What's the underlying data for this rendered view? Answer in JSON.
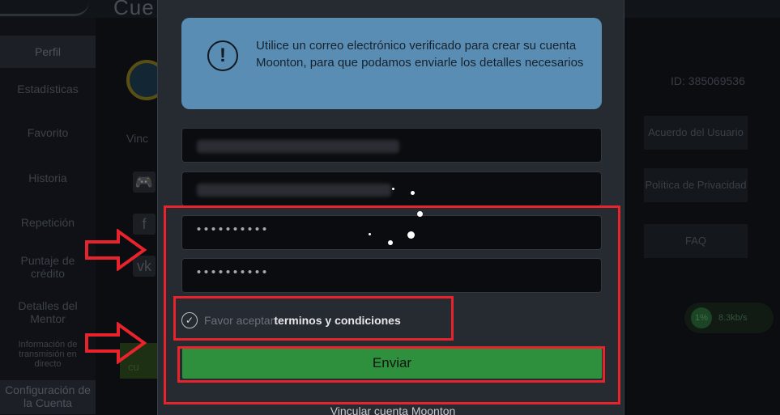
{
  "background": {
    "title": "Cue",
    "sidebar": [
      {
        "label": "Perfil",
        "active": true
      },
      {
        "label": "Estadísticas"
      },
      {
        "label": "Favorito"
      },
      {
        "label": "Historia"
      },
      {
        "label": "Repetición"
      },
      {
        "label": "Puntaje de crédito"
      },
      {
        "label": "Detalles del Mentor"
      },
      {
        "label": "Información de transmisión en directo"
      },
      {
        "label": "Configuración de la Cuenta"
      }
    ],
    "link_label": "Vinc",
    "green_button": "cu",
    "user_id": "ID: 385069536",
    "right_buttons": [
      "Acuerdo del Usuario",
      "Política de Privacidad",
      "FAQ"
    ],
    "speed": {
      "percent": "1%",
      "rate": "8.3kb/s"
    }
  },
  "modal": {
    "notice": {
      "icon": "info-exclamation-icon",
      "text": "Utilice un correo electrónico verificado para crear su cuenta Moonton, para que podamos enviarle los detalles necesarios"
    },
    "password_mask": "••••••••••",
    "confirm_mask": "••••••••••",
    "terms": {
      "prefix": "Favor aceptar",
      "link": "terminos y condiciones",
      "checked": true
    },
    "submit_label": "Enviar",
    "footer": "Vincular cuenta Moonton"
  },
  "colors": {
    "accent_green": "#2e8f3c",
    "notice_blue": "#5a8db3",
    "annotation_red": "#e8232b"
  }
}
